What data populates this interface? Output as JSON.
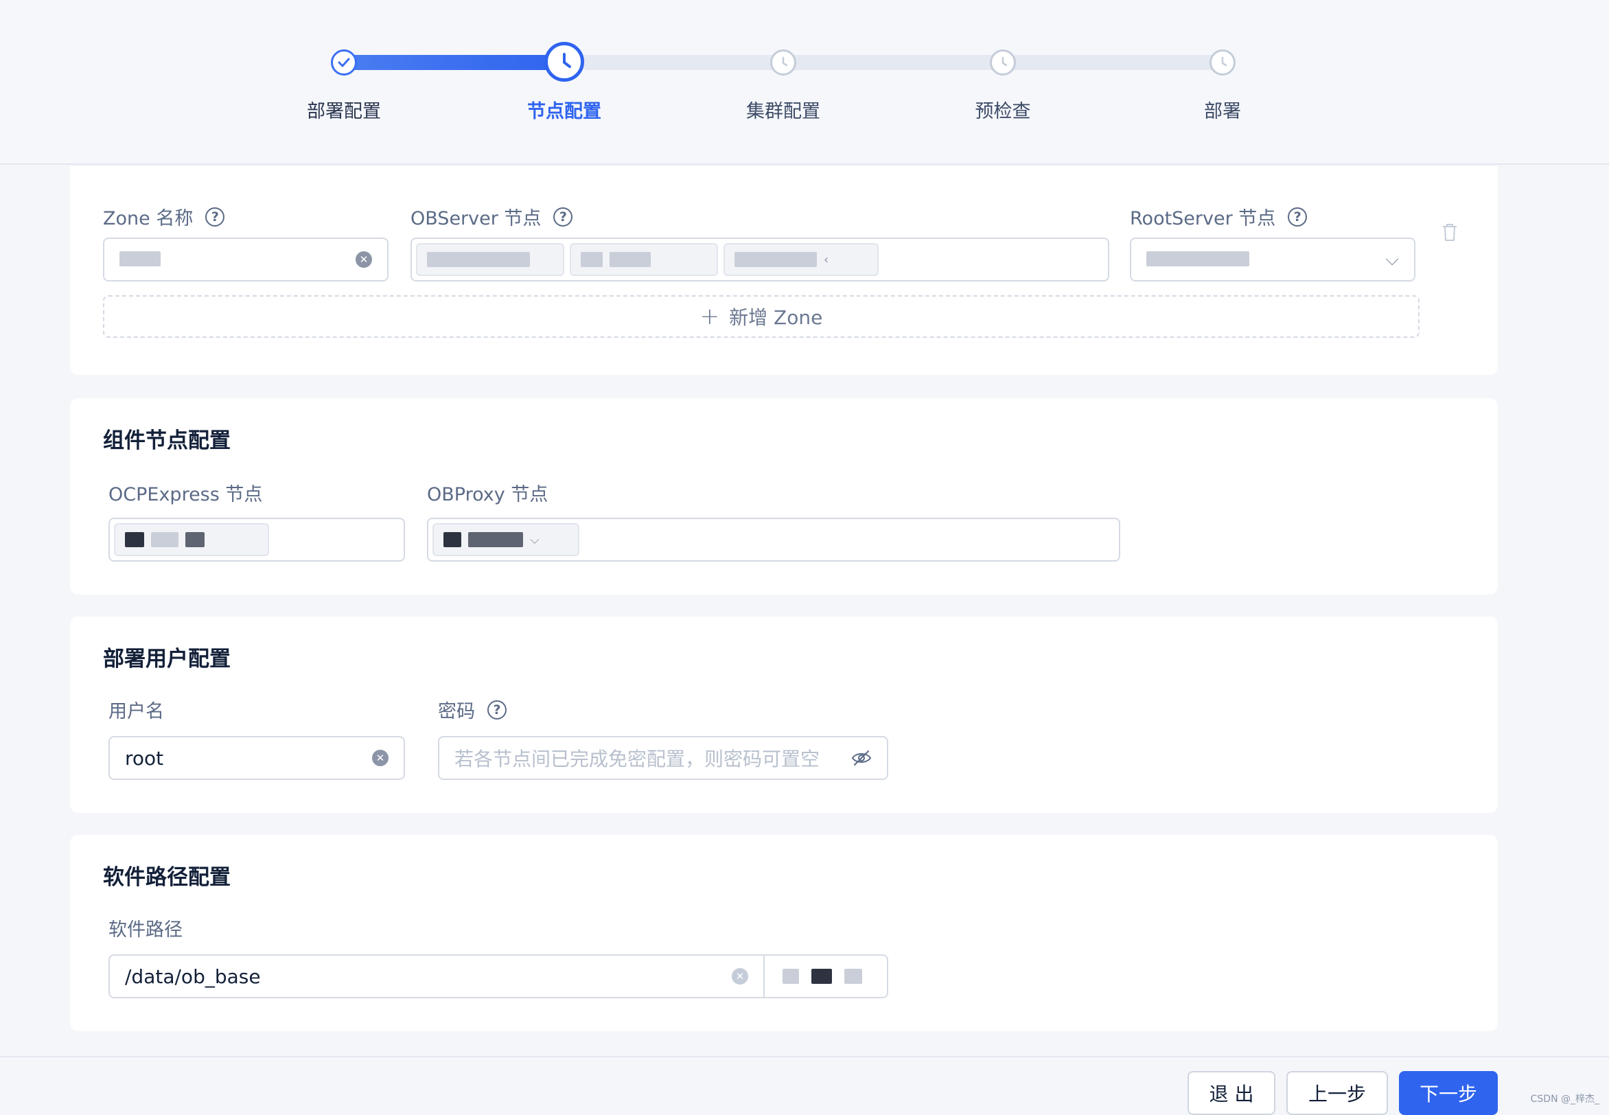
{
  "steps": [
    {
      "label": "部署配置",
      "state": "finished"
    },
    {
      "label": "节点配置",
      "state": "current"
    },
    {
      "label": "集群配置",
      "state": "waiting"
    },
    {
      "label": "预检查",
      "state": "waiting"
    },
    {
      "label": "部署",
      "state": "waiting"
    }
  ],
  "zone_card": {
    "zone_name_label": "Zone 名称",
    "observer_label": "OBServer 节点",
    "rootserver_label": "RootServer 节点",
    "add_zone_label": "新增 Zone",
    "add_icon": "plus-icon",
    "delete_icon": "trash-icon",
    "help_icon": "question-circle-icon"
  },
  "component_card": {
    "title": "组件节点配置",
    "ocpexpress_label": "OCPExpress 节点",
    "obproxy_label": "OBProxy 节点"
  },
  "user_card": {
    "title": "部署用户配置",
    "username_label": "用户名",
    "username_value": "root",
    "password_label": "密码",
    "password_placeholder": "若各节点间已完成免密配置，则密码可置空",
    "password_icon": "eye-invisible-icon"
  },
  "path_card": {
    "title": "软件路径配置",
    "path_label": "软件路径",
    "path_value": "/data/ob_base"
  },
  "footer": {
    "exit_label": "退 出",
    "prev_label": "上一步",
    "next_label": "下一步"
  },
  "watermark": "CSDN @_梓杰_",
  "colors": {
    "primary": "#2f64ef",
    "text": "#132039",
    "muted": "#5b6a86",
    "border": "#d5dae4"
  }
}
